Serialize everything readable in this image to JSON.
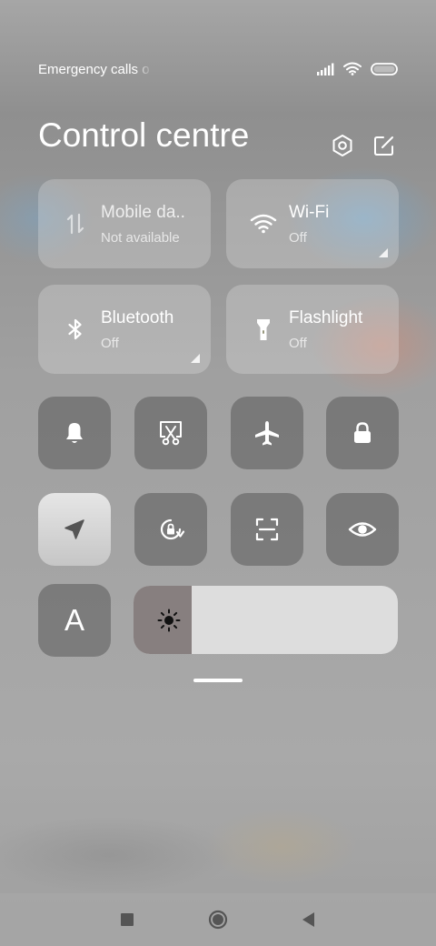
{
  "status_bar": {
    "carrier_text": "Emergency calls o",
    "icons": [
      "signal-icon",
      "wifi-icon",
      "battery-icon"
    ]
  },
  "header": {
    "title": "Control centre",
    "actions": [
      "settings-icon",
      "edit-icon"
    ]
  },
  "tiles": [
    {
      "icon": "mobile-data-icon",
      "title": "Mobile da..",
      "subtitle": "Not available",
      "state": "unavailable"
    },
    {
      "icon": "wifi-icon",
      "title": "Wi-Fi",
      "subtitle": "Off",
      "state": "off",
      "expandable": true
    },
    {
      "icon": "bluetooth-icon",
      "title": "Bluetooth",
      "subtitle": "Off",
      "state": "off",
      "expandable": true
    },
    {
      "icon": "flashlight-icon",
      "title": "Flashlight",
      "subtitle": "Off",
      "state": "off"
    }
  ],
  "toggles_row1": [
    {
      "icon": "bell-icon",
      "active": false
    },
    {
      "icon": "screenshot-icon",
      "active": false
    },
    {
      "icon": "airplane-icon",
      "active": false
    },
    {
      "icon": "lock-icon",
      "active": false
    }
  ],
  "toggles_row2": [
    {
      "icon": "location-icon",
      "active": true
    },
    {
      "icon": "rotation-lock-icon",
      "active": false
    },
    {
      "icon": "scan-icon",
      "active": false
    },
    {
      "icon": "eye-icon",
      "active": false
    }
  ],
  "auto_brightness": {
    "label": "A",
    "icon": "font-size-icon"
  },
  "brightness": {
    "level": 0.22,
    "icon": "sun-icon"
  },
  "navbar": [
    "recents-icon",
    "home-icon",
    "back-icon"
  ],
  "colors": {
    "tile_bg": "rgba(255,255,255,0.22)",
    "toggle_bg": "#6d6d6d",
    "toggle_active_bg": "#dcdcdc",
    "text": "#ffffff"
  }
}
